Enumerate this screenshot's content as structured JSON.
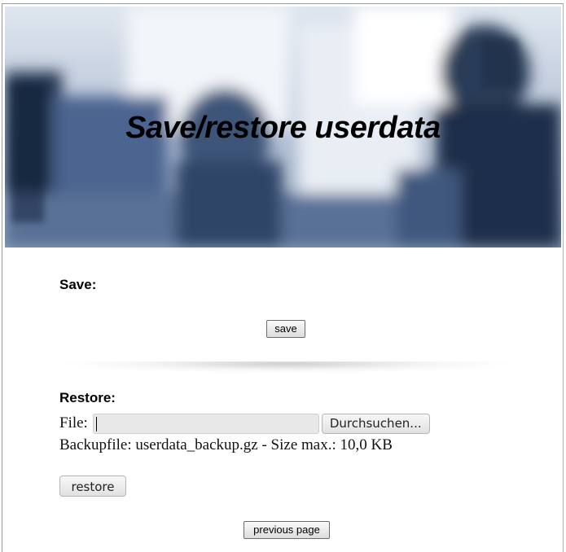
{
  "banner": {
    "title": "Save/restore userdata"
  },
  "save": {
    "heading": "Save:",
    "button_label": "save"
  },
  "restore": {
    "heading": "Restore:",
    "file_label": "File:",
    "file_value": "",
    "browse_label": "Durchsuchen...",
    "backup_info": "Backupfile: userdata_backup.gz - Size max.: 10,0 KB",
    "button_label": "restore"
  },
  "nav": {
    "previous_label": "previous page"
  }
}
